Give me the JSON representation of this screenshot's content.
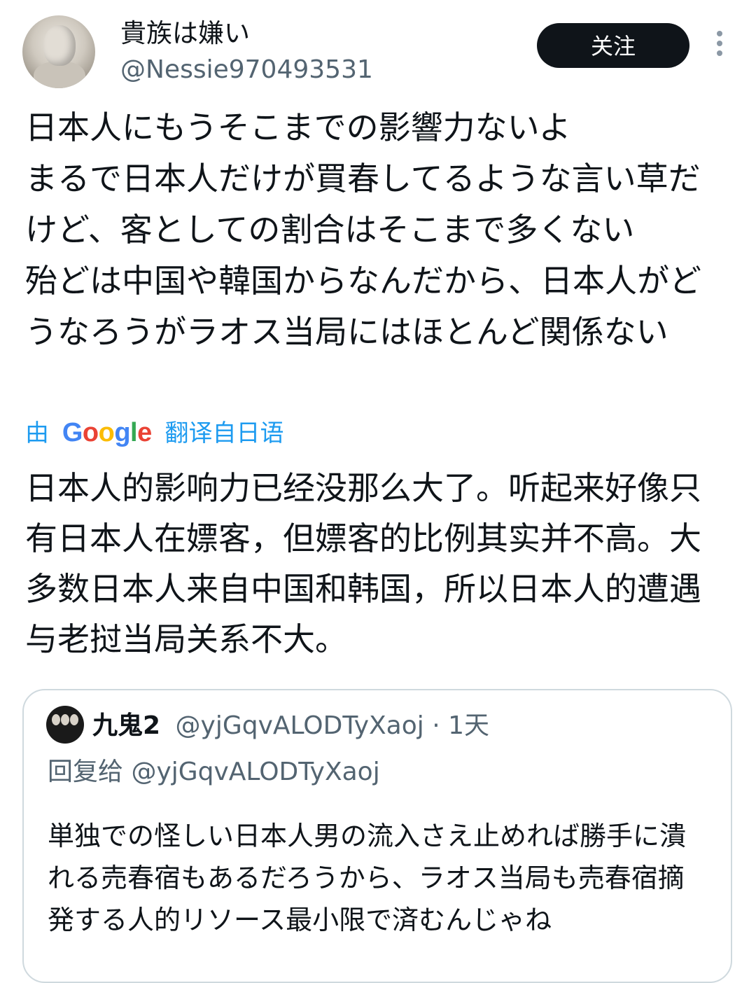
{
  "author": {
    "display_name": "貴族は嫌い",
    "handle": "@Nessie970493531",
    "follow_label": "关注"
  },
  "tweet": {
    "text": "日本人にもうそこまでの影響力ないよ\nまるで日本人だけが買春してるような言い草だけど、客としての割合はそこまで多くない\n殆どは中国や韓国からなんだから、日本人がどうなろうがラオス当局にはほとんど関係ない"
  },
  "translation": {
    "prefix": "由",
    "provider": "Google",
    "suffix": "翻译自日语",
    "text": "日本人的影响力已经没那么大了。听起来好像只有日本人在嫖客，但嫖客的比例其实并不高。大多数日本人来自中国和韩国，所以日本人的遭遇与老挝当局关系不大。"
  },
  "quoted_tweet": {
    "display_name": "九鬼2",
    "meta": "@yjGqvALODTyXaoj · 1天",
    "reply_to": "回复给 @yjGqvALODTyXaoj",
    "text": "単独での怪しい日本人男の流入さえ止めれば勝手に潰れる売春宿もあるだろうから、ラオス当局も売春宿摘発する人的リソース最小限で済むんじゃね"
  },
  "icons": {
    "more": "more-vertical-icon",
    "avatar": "author-avatar-bust",
    "google": "google-logo"
  },
  "colors": {
    "text": "#0f1419",
    "secondary": "#536471",
    "link": "#1d9bf0",
    "follow_bg": "#0f1419",
    "border": "#cfd9de"
  }
}
